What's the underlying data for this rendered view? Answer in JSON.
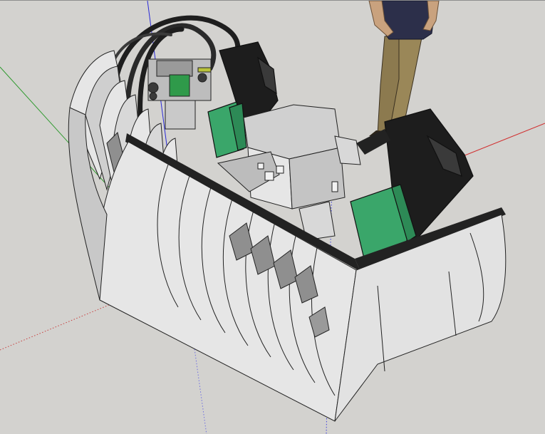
{
  "viewport": {
    "background": "#d3d2cf",
    "model": "cockpit-tub",
    "axes": {
      "red": "#d13030",
      "green": "#2f9a2f",
      "blue": "#2a2ad8"
    }
  },
  "colors": {
    "frame_edge": "#222222",
    "panel_light": "#e4e4e4",
    "panel_mid": "#c9c9c9",
    "panel_dark": "#8f8f8f",
    "seat_black": "#1d1d1d",
    "seat_green": "#3aa66a",
    "figure_shirt": "#2c2f4a",
    "figure_pants": "#8c7a4f",
    "figure_skin": "#c9a27e"
  },
  "elements": [
    "rear-ejection-seat",
    "front-ejection-seat",
    "instrument-panel",
    "center-console",
    "canopy-rails",
    "fuselage-frames",
    "human-scale-figure"
  ]
}
